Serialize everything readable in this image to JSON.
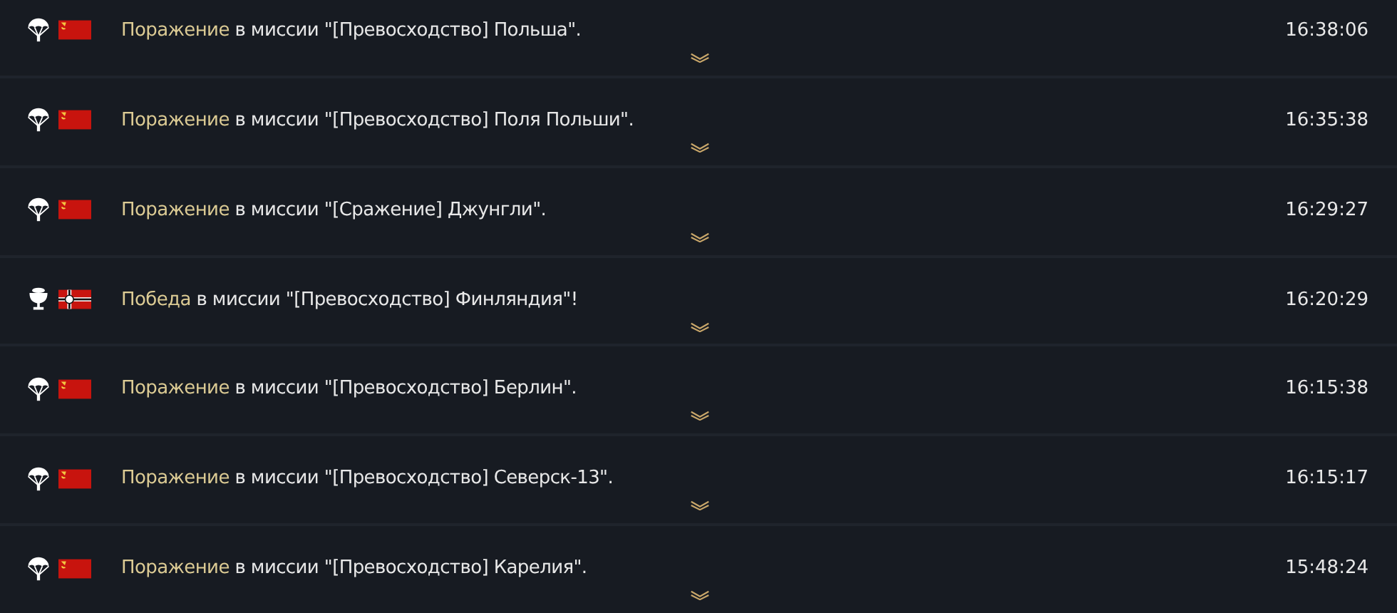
{
  "events": [
    {
      "kind": "defeat",
      "flag": {
        "kind": "ussr"
      },
      "result": "Поражение",
      "text": " в миссии \"[Превосходство] Польша\".",
      "time": "16:38:06"
    },
    {
      "kind": "defeat",
      "flag": {
        "kind": "ussr"
      },
      "result": "Поражение",
      "text": " в миссии \"[Превосходство] Поля Польши\".",
      "time": "16:35:38"
    },
    {
      "kind": "defeat",
      "flag": {
        "kind": "ussr"
      },
      "result": "Поражение",
      "text": " в миссии \"[Сражение] Джунгли\".",
      "time": "16:29:27"
    },
    {
      "kind": "victory",
      "flag": {
        "kind": "germany"
      },
      "result": "Победа",
      "text": " в миссии \"[Превосходство] Финляндия\"!",
      "time": "16:20:29"
    },
    {
      "kind": "defeat",
      "flag": {
        "kind": "ussr"
      },
      "result": "Поражение",
      "text": " в миссии \"[Превосходство] Берлин\".",
      "time": "16:15:38"
    },
    {
      "kind": "defeat",
      "flag": {
        "kind": "ussr"
      },
      "result": "Поражение",
      "text": " в миссии \"[Превосходство] Северск-13\".",
      "time": "16:15:17"
    },
    {
      "kind": "defeat",
      "flag": {
        "kind": "ussr"
      },
      "result": "Поражение",
      "text": " в миссии \"[Превосходство] Карелия\".",
      "time": "15:48:24"
    }
  ]
}
